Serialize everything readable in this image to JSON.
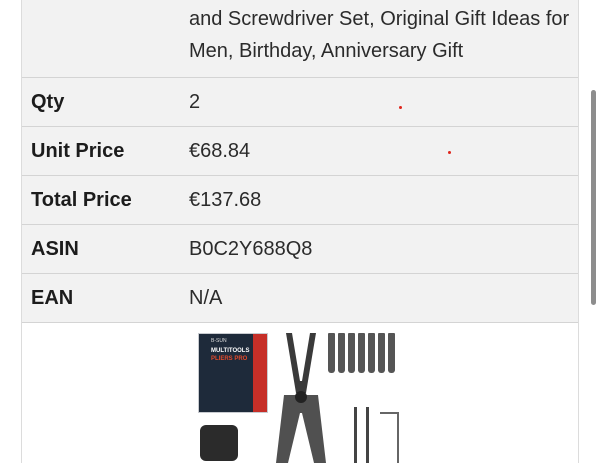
{
  "product_title_tail": "and Screwdriver Set, Original Gift Ideas for Men, Birthday, Anniversary Gift",
  "rows": [
    {
      "label": "Qty",
      "value": "2"
    },
    {
      "label": "Unit Price",
      "value": "€68.84"
    },
    {
      "label": "Total Price",
      "value": "€137.68"
    },
    {
      "label": "ASIN",
      "value": "B0C2Y688Q8"
    },
    {
      "label": "EAN",
      "value": "N/A"
    }
  ],
  "image": {
    "box_brand": "B-SUN",
    "box_title_1": "MULTITOOLS",
    "box_title_2": "PLIERS PRO"
  }
}
